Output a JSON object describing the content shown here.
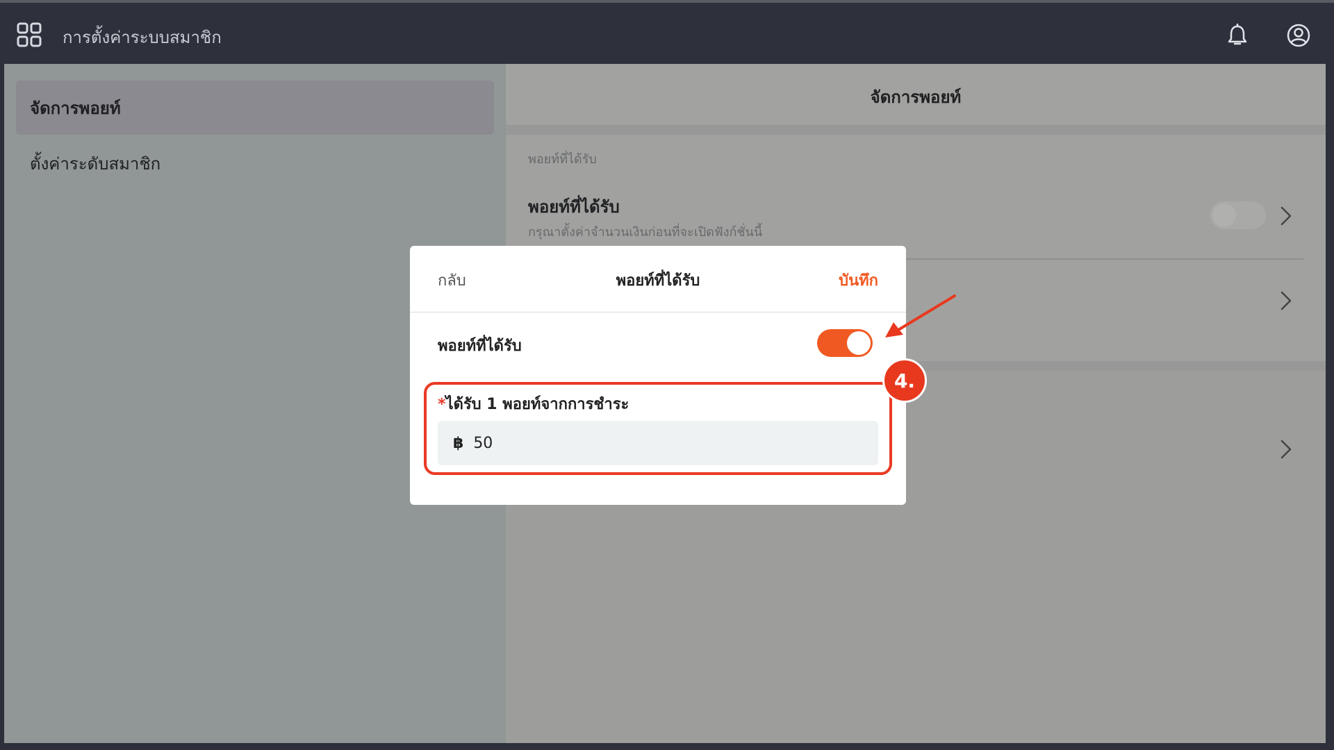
{
  "header": {
    "title": "การตั้งค่าระบบสมาชิก",
    "apps_icon": "grid-apps-icon",
    "bell_icon": "bell-icon",
    "user_icon": "user-circle-icon"
  },
  "sidebar": {
    "items": [
      {
        "label": "จัดการพอยท์",
        "active": true
      },
      {
        "label": "ตั้งค่าระดับสมาชิก",
        "active": false
      }
    ]
  },
  "content": {
    "title": "จัดการพอยท์",
    "section_caption": "พอยท์ที่ได้รับ",
    "row": {
      "title": "พอยท์ที่ได้รับ",
      "description": "กรุณาตั้งค่าจำนวนเงินก่อนที่จะเปิดฟังก์ชั่นนี้",
      "enabled": false
    }
  },
  "modal": {
    "back_label": "กลับ",
    "title": "พอยท์ที่ได้รับ",
    "save_label": "บันทึก",
    "toggle_label": "พอยท์ที่ได้รับ",
    "toggle_on": true,
    "field_required_mark": "*",
    "field_label": "ได้รับ 1 พอยท์จากการชำระ",
    "currency_symbol": "฿",
    "field_value": "50"
  },
  "annotation": {
    "step": "4."
  },
  "colors": {
    "accent": "#f05a22",
    "annotation": "#e8391f"
  }
}
